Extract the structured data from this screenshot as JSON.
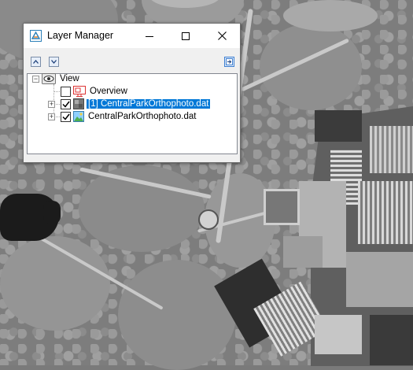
{
  "window": {
    "title": "Layer Manager"
  },
  "toolbar": {
    "move_up": "arrow-up-icon",
    "move_down": "arrow-down-icon",
    "options": "layer-options-icon"
  },
  "tree": {
    "root_label": "View",
    "items": [
      {
        "label": "Overview",
        "checked": false,
        "expandable": false,
        "selected": false
      },
      {
        "label": "[1] CentralParkOrthophoto.dat",
        "checked": true,
        "expandable": true,
        "selected": true
      },
      {
        "label": "CentralParkOrthophoto.dat",
        "checked": true,
        "expandable": true,
        "selected": false
      }
    ]
  },
  "colors": {
    "selection": "#0078d7",
    "window_bg": "#f0f0f0"
  }
}
